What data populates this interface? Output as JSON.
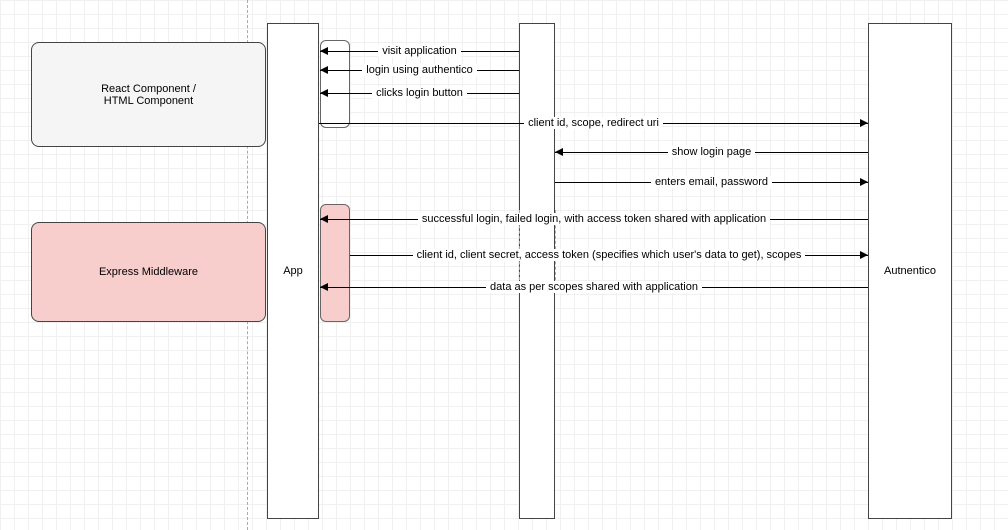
{
  "boxes": {
    "react": "React Component /\nHTML Component",
    "express": "Express Middleware"
  },
  "lifelines": {
    "app": "App",
    "user": "",
    "authentico": "Autnentico"
  },
  "messages": {
    "m1": "visit application",
    "m2": "login using authentico",
    "m3": "clicks login button",
    "m4": "client id, scope, redirect uri",
    "m5": "show login page",
    "m6": "enters email, password",
    "m7": "successful login, failed login, with access token shared with application",
    "m8": "client id, client secret, access token (specifies which user's data to get), scopes",
    "m9": "data as per scopes shared with application"
  }
}
